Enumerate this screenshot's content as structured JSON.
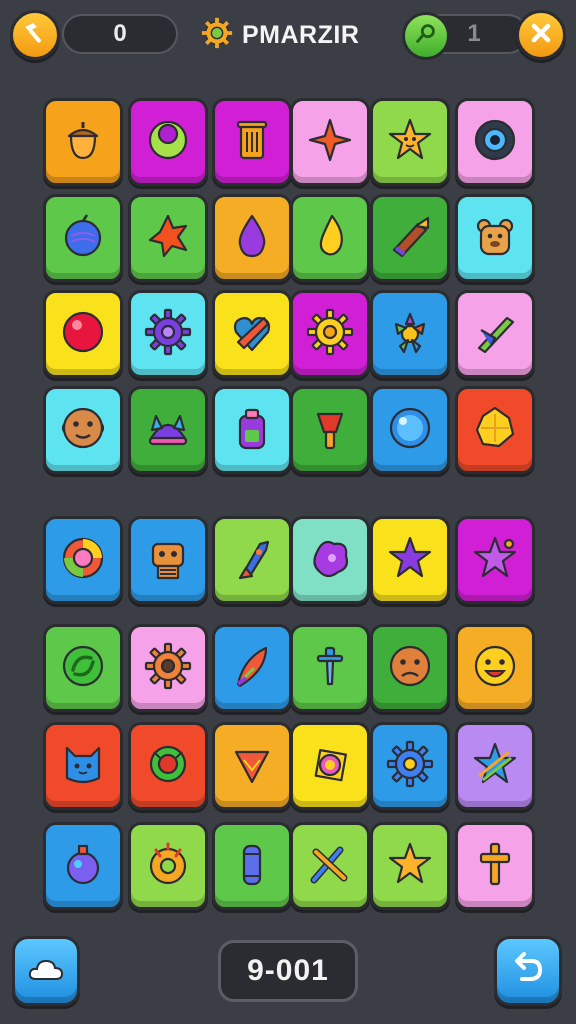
{
  "header": {
    "score": "0",
    "title": "PMARZIR",
    "counter": "1",
    "back_icon": "hammer-back-icon",
    "close_icon": "close-icon",
    "title_icon": "gear-icon",
    "counter_icon": "green-hint-icon"
  },
  "board": {
    "rows": [
      [
        {
          "color": "#f7a21b",
          "icon": "acorn-icon"
        },
        {
          "color": "#d11fd6",
          "icon": "green-orb-icon"
        },
        {
          "color": "#d11fd6",
          "icon": "trash-can-icon"
        },
        {
          "color": "#f6a2e8",
          "icon": "four-point-star-icon"
        },
        {
          "color": "#8fd94a",
          "icon": "star-face-icon"
        },
        {
          "color": "#f6a2e8",
          "icon": "camera-lens-icon"
        }
      ],
      [
        {
          "color": "#5ec84a",
          "icon": "blue-berry-icon"
        },
        {
          "color": "#5ec84a",
          "icon": "orange-splat-icon"
        },
        {
          "color": "#f5ad25",
          "icon": "purple-drop-icon"
        },
        {
          "color": "#5ec84a",
          "icon": "yellow-flame-icon"
        },
        {
          "color": "#3fae3a",
          "icon": "paint-brush-icon"
        },
        {
          "color": "#5ee3f0",
          "icon": "bear-face-icon"
        }
      ],
      [
        {
          "color": "#f9e21b",
          "icon": "red-ball-icon"
        },
        {
          "color": "#5ee3f0",
          "icon": "purple-gear-icon"
        },
        {
          "color": "#f9e21b",
          "icon": "candy-heart-icon"
        },
        {
          "color": "#d11fd6",
          "icon": "yellow-gear-icon"
        },
        {
          "color": "#2e9be8",
          "icon": "leaf-cluster-icon"
        },
        {
          "color": "#f6a2e8",
          "icon": "green-sword-icon"
        }
      ],
      [
        {
          "color": "#5ee3f0",
          "icon": "monkey-face-icon"
        },
        {
          "color": "#3fae3a",
          "icon": "purple-hat-icon"
        },
        {
          "color": "#5ee3f0",
          "icon": "potion-jar-icon"
        },
        {
          "color": "#3fae3a",
          "icon": "red-torch-icon"
        },
        {
          "color": "#2e9be8",
          "icon": "blue-bubble-icon"
        },
        {
          "color": "#f04a2a",
          "icon": "yellow-shell-icon"
        }
      ],
      [
        {
          "color": "#2e9be8",
          "icon": "rainbow-ball-icon"
        },
        {
          "color": "#2e9be8",
          "icon": "robot-face-icon"
        },
        {
          "color": "#8fd94a",
          "icon": "rocket-icon"
        },
        {
          "color": "#7fe0c6",
          "icon": "purple-blob-icon"
        },
        {
          "color": "#f9e21b",
          "icon": "purple-star-icon"
        },
        {
          "color": "#d11fd6",
          "icon": "star-cluster-icon"
        }
      ],
      [
        {
          "color": "#5ec84a",
          "icon": "green-swirl-icon"
        },
        {
          "color": "#f6a2e8",
          "icon": "orange-gear-icon"
        },
        {
          "color": "#2e9be8",
          "icon": "feather-brush-icon"
        },
        {
          "color": "#5ec84a",
          "icon": "sword-hilt-icon"
        },
        {
          "color": "#3fae3a",
          "icon": "frown-face-icon"
        },
        {
          "color": "#f5ad25",
          "icon": "smile-face-icon"
        }
      ],
      [
        {
          "color": "#f04a2a",
          "icon": "blue-cat-icon"
        },
        {
          "color": "#f04a2a",
          "icon": "green-ring-icon"
        },
        {
          "color": "#f5ad25",
          "icon": "ice-cream-icon"
        },
        {
          "color": "#f9e21b",
          "icon": "pink-ring-icon"
        },
        {
          "color": "#2e9be8",
          "icon": "blue-gear-icon"
        },
        {
          "color": "#b98af2",
          "icon": "rainbow-star-icon"
        }
      ],
      [
        {
          "color": "#2e9be8",
          "icon": "potion-bottle-icon"
        },
        {
          "color": "#8fd94a",
          "icon": "orange-donut-icon"
        },
        {
          "color": "#5ec84a",
          "icon": "blue-pillar-icon"
        },
        {
          "color": "#8fd94a",
          "icon": "crossed-tools-icon"
        },
        {
          "color": "#8fd94a",
          "icon": "gold-star-icon"
        },
        {
          "color": "#f6a2e8",
          "icon": "cross-icon"
        }
      ]
    ]
  },
  "footer": {
    "level": "9-001",
    "left_icon": "cloud-icon",
    "right_icon": "undo-icon"
  }
}
